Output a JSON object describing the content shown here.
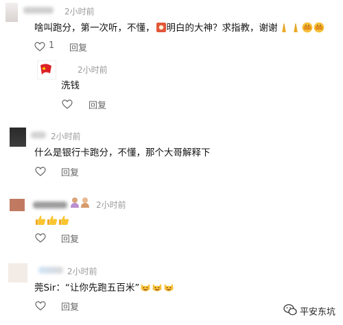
{
  "comments": [
    {
      "time": "2小时前",
      "text": "啥叫跑分，第一次听，不懂，",
      "text_after_icon": "明白的大神？求指教，谢谢",
      "inline_icon": "badge-icon",
      "emojis": [
        "folded-hands-emoji",
        "folded-hands-emoji",
        "fist-bump-emoji",
        "fist-bump-emoji"
      ],
      "like_count": "1",
      "reply_label": "回复",
      "reply": {
        "time": "2小时前",
        "text": "洗钱",
        "reply_label": "回复"
      }
    },
    {
      "time": "2小时前",
      "text": "什么是银行卡跑分，不懂，那个大哥解释下",
      "reply_label": "回复"
    },
    {
      "time": "2小时前",
      "emojis": [
        "thumbs-up-emoji",
        "thumbs-up-emoji",
        "thumbs-up-emoji"
      ],
      "reply_label": "回复"
    },
    {
      "time": "2小时前",
      "text": "莞Sir：“让你先跑五百米”",
      "emojis": [
        "grinning-cat-emoji",
        "grinning-cat-emoji",
        "grinning-cat-emoji"
      ],
      "reply_label": "回复"
    }
  ],
  "watermark": {
    "text": "平安东坑",
    "icon": "wechat-icon"
  }
}
